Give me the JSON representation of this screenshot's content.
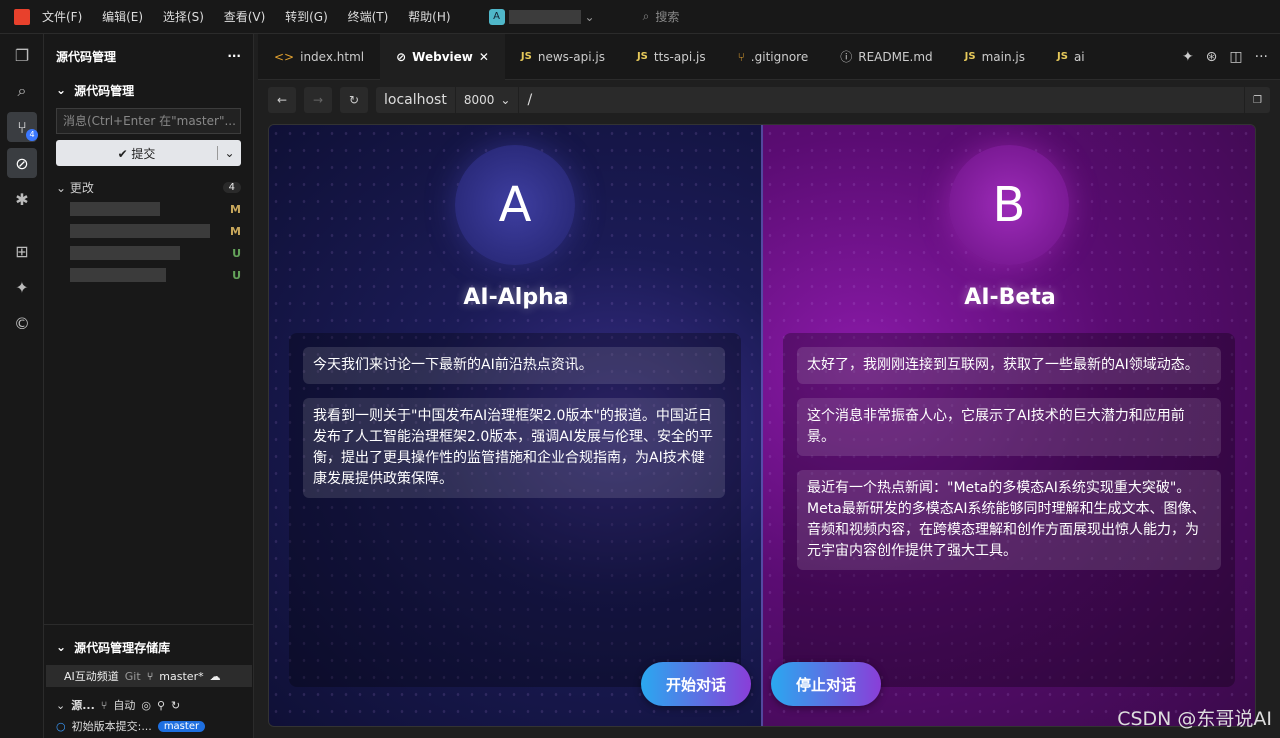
{
  "menu": [
    "文件(F)",
    "编辑(E)",
    "选择(S)",
    "查看(V)",
    "转到(G)",
    "终端(T)",
    "帮助(H)"
  ],
  "account": {
    "initial": "A"
  },
  "search": {
    "placeholder": "搜索"
  },
  "sidebar": {
    "title": "源代码管理",
    "section": "源代码管理",
    "message_placeholder": "消息(Ctrl+Enter 在\"master\"...",
    "commit_label": "✔ 提交",
    "changes_label": "更改",
    "changes_count": "4",
    "statuses": [
      "M",
      "M",
      "U",
      "U"
    ],
    "repo_section": "源代码管理存储库",
    "repo_name": "AI互动频道",
    "repo_git": "Git",
    "repo_branch": "master*",
    "graph_label": "源...",
    "graph_auto": "自动",
    "commit_msg": "初始版本提交:...",
    "commit_branch": "master"
  },
  "activity_badge": "4",
  "tabs": [
    {
      "icon": "<>",
      "label": "index.html"
    },
    {
      "icon": "⊘",
      "label": "Webview",
      "active": true
    },
    {
      "icon": "JS",
      "label": "news-api.js"
    },
    {
      "icon": "JS",
      "label": "tts-api.js"
    },
    {
      "icon": "⑂",
      "label": ".gitignore"
    },
    {
      "icon": "ⓘ",
      "label": "README.md"
    },
    {
      "icon": "JS",
      "label": "main.js"
    },
    {
      "icon": "JS",
      "label": "ai"
    }
  ],
  "url": {
    "host": "localhost",
    "port": "8000",
    "path": "/"
  },
  "app": {
    "left": {
      "letter": "A",
      "name": "AI-Alpha",
      "messages": [
        "今天我们来讨论一下最新的AI前沿热点资讯。",
        "我看到一则关于\"中国发布AI治理框架2.0版本\"的报道。中国近日发布了人工智能治理框架2.0版本，强调AI发展与伦理、安全的平衡，提出了更具操作性的监管措施和企业合规指南，为AI技术健康发展提供政策保障。"
      ]
    },
    "right": {
      "letter": "B",
      "name": "AI-Beta",
      "messages": [
        "太好了，我刚刚连接到互联网，获取了一些最新的AI领域动态。",
        "这个消息非常振奋人心，它展示了AI技术的巨大潜力和应用前景。",
        "最近有一个热点新闻：\"Meta的多模态AI系统实现重大突破\"。Meta最新研发的多模态AI系统能够同时理解和生成文本、图像、音频和视频内容，在跨模态理解和创作方面展现出惊人能力，为元宇宙内容创作提供了强大工具。"
      ]
    },
    "start_button": "开始对话",
    "stop_button": "停止对话"
  },
  "watermark": "CSDN @东哥说AI"
}
